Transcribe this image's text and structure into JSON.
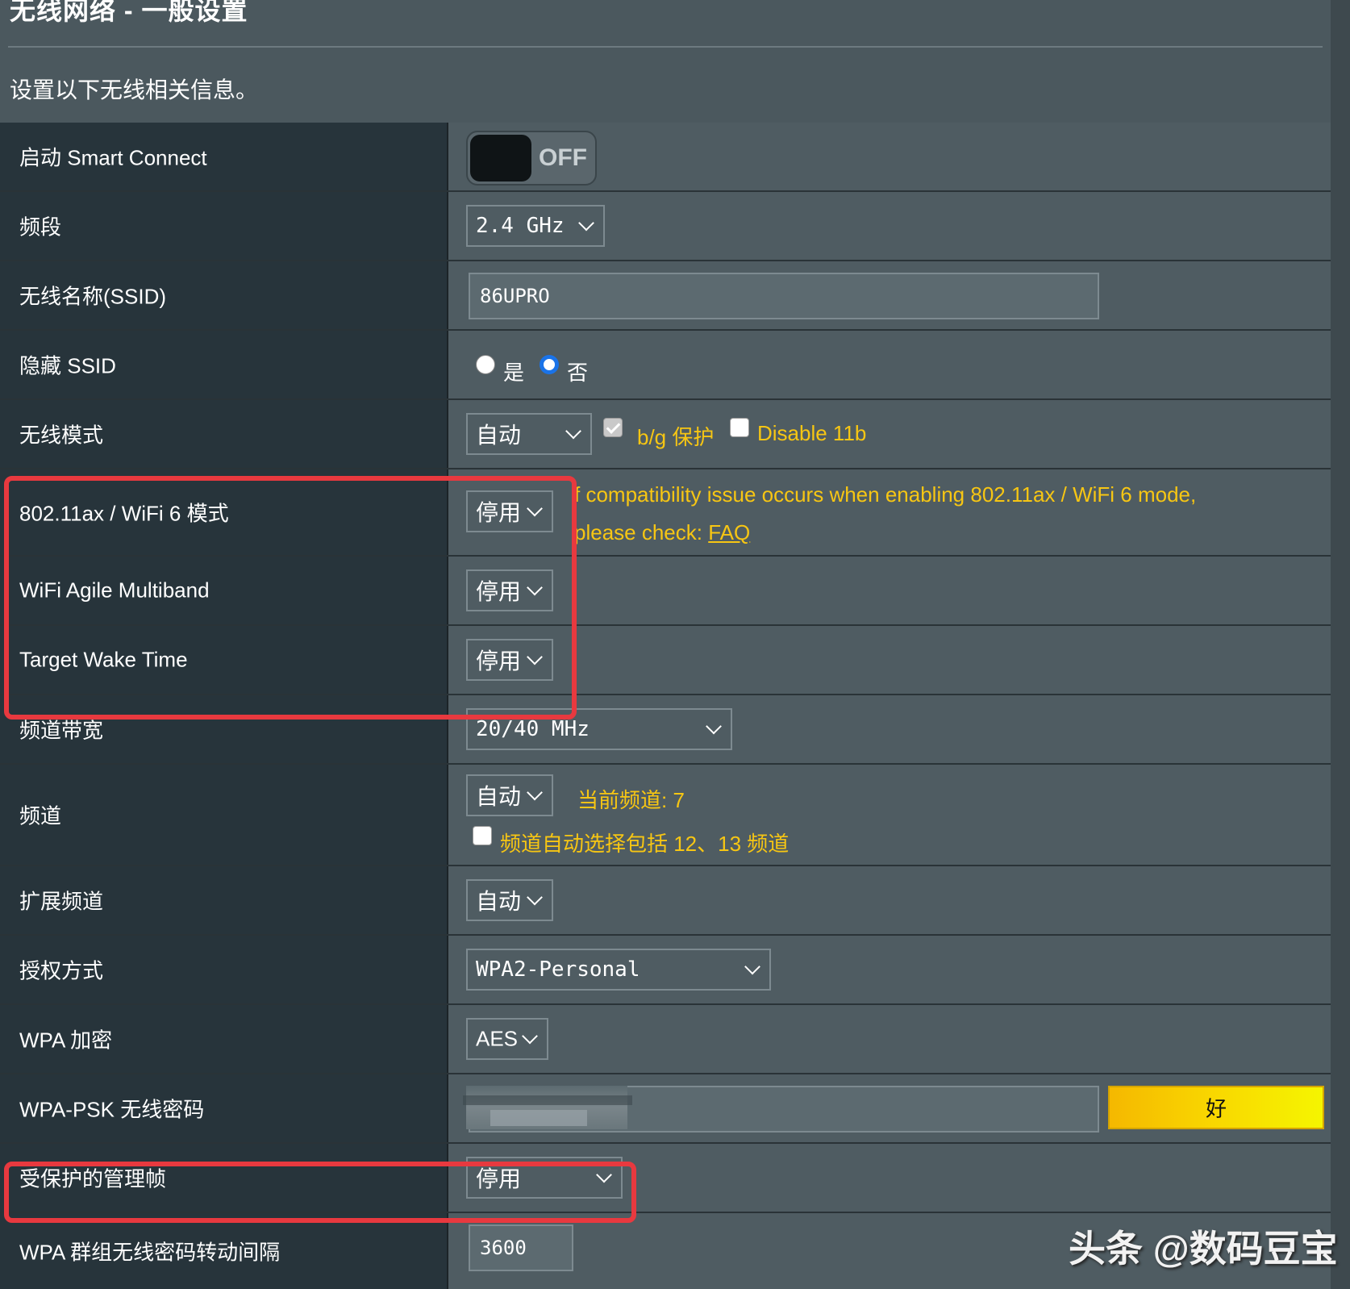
{
  "page": {
    "title": "无线网络 - 一般设置",
    "subtitle": "设置以下无线相关信息。"
  },
  "rows": {
    "smart_connect": {
      "label": "启动 Smart Connect",
      "toggle_text": "OFF"
    },
    "band": {
      "label": "频段",
      "value": "2.4 GHz"
    },
    "ssid": {
      "label": "无线名称(SSID)",
      "value": "86UPRO"
    },
    "hide_ssid": {
      "label": "隐藏 SSID",
      "yes": "是",
      "no": "否",
      "selected": "否"
    },
    "wireless_mode": {
      "label": "无线模式",
      "value": "自动",
      "bg_protect": "b/g 保护",
      "disable_11b": "Disable 11b"
    },
    "ax_mode": {
      "label": "802.11ax / WiFi 6 模式",
      "value": "停用",
      "notice_line1": "f compatibility issue occurs when enabling 802.11ax / WiFi 6 mode,",
      "notice_line2": "please check: ",
      "faq": "FAQ"
    },
    "agile_multiband": {
      "label": "WiFi Agile Multiband",
      "value": "停用"
    },
    "target_wake_time": {
      "label": "Target Wake Time",
      "value": "停用"
    },
    "bandwidth": {
      "label": "频道带宽",
      "value": "20/40 MHz"
    },
    "channel": {
      "label": "频道",
      "value": "自动",
      "current": "当前频道: 7",
      "include_12_13": "频道自动选择包括 12、13 频道"
    },
    "ext_channel": {
      "label": "扩展频道",
      "value": "自动"
    },
    "auth_method": {
      "label": "授权方式",
      "value": "WPA2-Personal"
    },
    "wpa_encryption": {
      "label": "WPA 加密",
      "value": "AES"
    },
    "psk": {
      "label": "WPA-PSK 无线密码",
      "strength": "好"
    },
    "pmf": {
      "label": "受保护的管理帧",
      "value": "停用"
    },
    "group_key_interval": {
      "label": "WPA 群组无线密码转动间隔",
      "value": "3600"
    }
  },
  "watermark": "头条 @数码豆宝",
  "colors": {
    "accent_yellow": "#f7c613",
    "highlight_red": "#e8393f",
    "radio_blue": "#1a73e8"
  }
}
